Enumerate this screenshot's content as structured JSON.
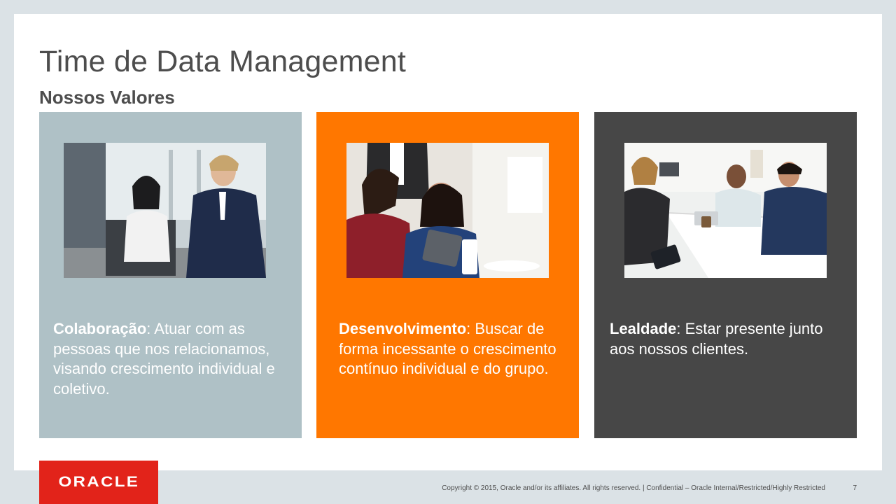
{
  "slide": {
    "title": "Time de Data Management",
    "subtitle": "Nossos Valores"
  },
  "cards": [
    {
      "term": "Colaboração",
      "separator": ":",
      "description": " Atuar com as pessoas que nos relacionamos, visando crescimento individual e coletivo.",
      "photo": "photo-two-colleagues-conversation",
      "color": "#afc1c6"
    },
    {
      "term": "Desenvolvimento",
      "separator": ":",
      "description": " Buscar de forma incessante o crescimento contínuo individual e do grupo.",
      "photo": "photo-team-looking-at-tablet",
      "color": "#ff7700"
    },
    {
      "term": "Lealdade",
      "separator": ":",
      "description": " Estar presente junto aos nossos clientes.",
      "photo": "photo-meeting-room-team",
      "color": "#474747"
    }
  ],
  "footer": {
    "logo_text": "ORACLE",
    "copyright": "Copyright © 2015, Oracle and/or its affiliates. All rights reserved.  |  Confidential – Oracle Internal/Restricted/Highly Restricted",
    "page_number": "7"
  },
  "colors": {
    "background": "#dbe2e6",
    "brand_red": "#e2231a",
    "title_gray": "#4d4d4d"
  }
}
